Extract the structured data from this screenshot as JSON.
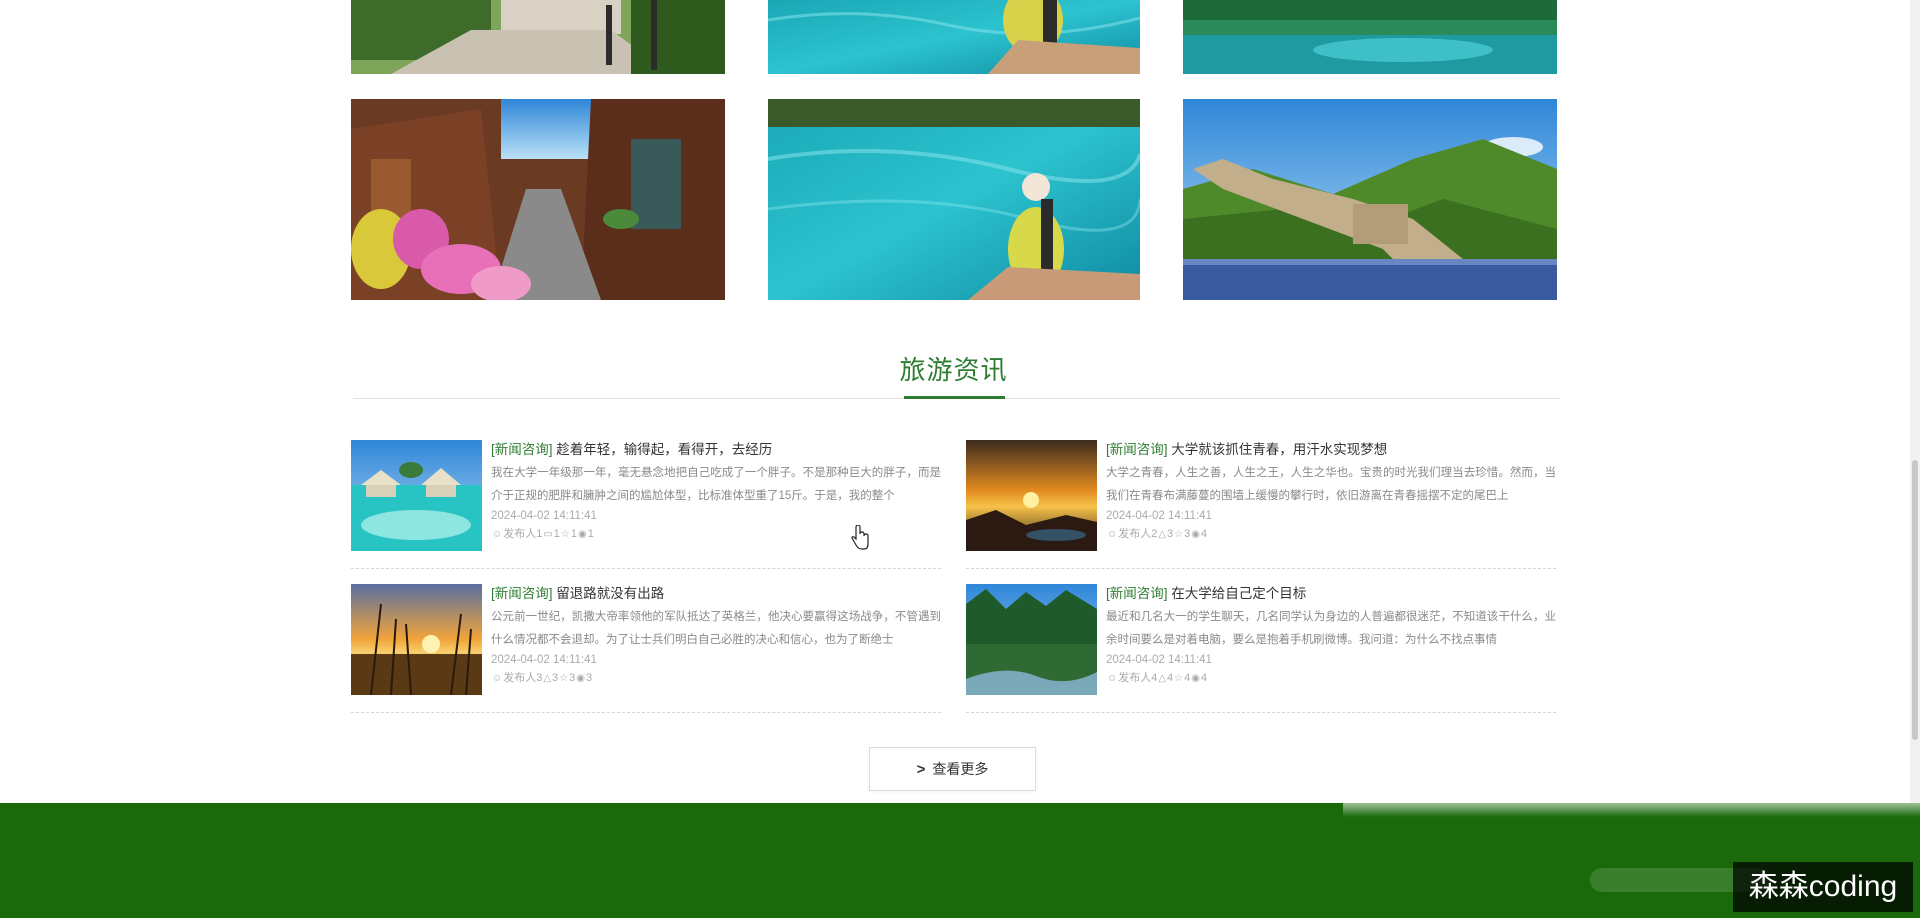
{
  "gallery": {
    "alts": [
      "城市街景",
      "湖上游客",
      "湖泊倒影",
      "古镇街道",
      "碧蓝湖泊",
      "长城"
    ]
  },
  "section": {
    "title": "旅游资讯"
  },
  "news": [
    {
      "tag": "[新闻咨询]",
      "title": "趁着年轻，输得起，看得开，去经历",
      "summary": "我在大学一年级那一年，毫无悬念地把自己吃成了一个胖子。不是那种巨大的胖子，而是介于正规的肥胖和臃肿之间的尴尬体型，比标准体型重了15斤。于是，我的整个",
      "date": "2024-04-02 14:11:41",
      "author": "发布人1",
      "count1": "1",
      "count2": "1",
      "count3": "1"
    },
    {
      "tag": "[新闻咨询]",
      "title": "大学就该抓住青春，用汗水实现梦想",
      "summary": "大学之青春，人生之善，人生之王，人生之华也。宝贵的时光我们理当去珍惜。然而，当我们在青春布满藤蔓的围墙上缓慢的攀行时，依旧游离在青春摇摆不定的尾巴上",
      "date": "2024-04-02 14:11:41",
      "author": "发布人2",
      "count1": "3",
      "count2": "3",
      "count3": "4"
    },
    {
      "tag": "[新闻咨询]",
      "title": "留退路就没有出路",
      "summary": "公元前一世纪，凯撒大帝率领他的军队抵达了英格兰，他决心要赢得这场战争，不管遇到什么情况都不会退却。为了让士兵们明白自己必胜的决心和信心，也为了断绝士",
      "date": "2024-04-02 14:11:41",
      "author": "发布人3",
      "count1": "3",
      "count2": "3",
      "count3": "3"
    },
    {
      "tag": "[新闻咨询]",
      "title": "在大学给自己定个目标",
      "summary": "最近和几名大一的学生聊天，几名同学认为身边的人普遍都很迷茫，不知道该干什么，业余时间要么是对着电脑，要么是抱着手机刷微博。我问道：为什么不找点事情",
      "date": "2024-04-02 14:11:41",
      "author": "发布人4",
      "count1": "4",
      "count2": "4",
      "count3": "4"
    }
  ],
  "more_button": {
    "chevron": ">",
    "label": "查看更多"
  },
  "watermark": "森森coding",
  "colors": {
    "accent": "#2e7d32",
    "footer": "#1a6a0c"
  },
  "icons": [
    "user-icon",
    "comment-icon",
    "like-icon",
    "view-icon",
    "chevron-right-icon",
    "hand-cursor-icon"
  ]
}
